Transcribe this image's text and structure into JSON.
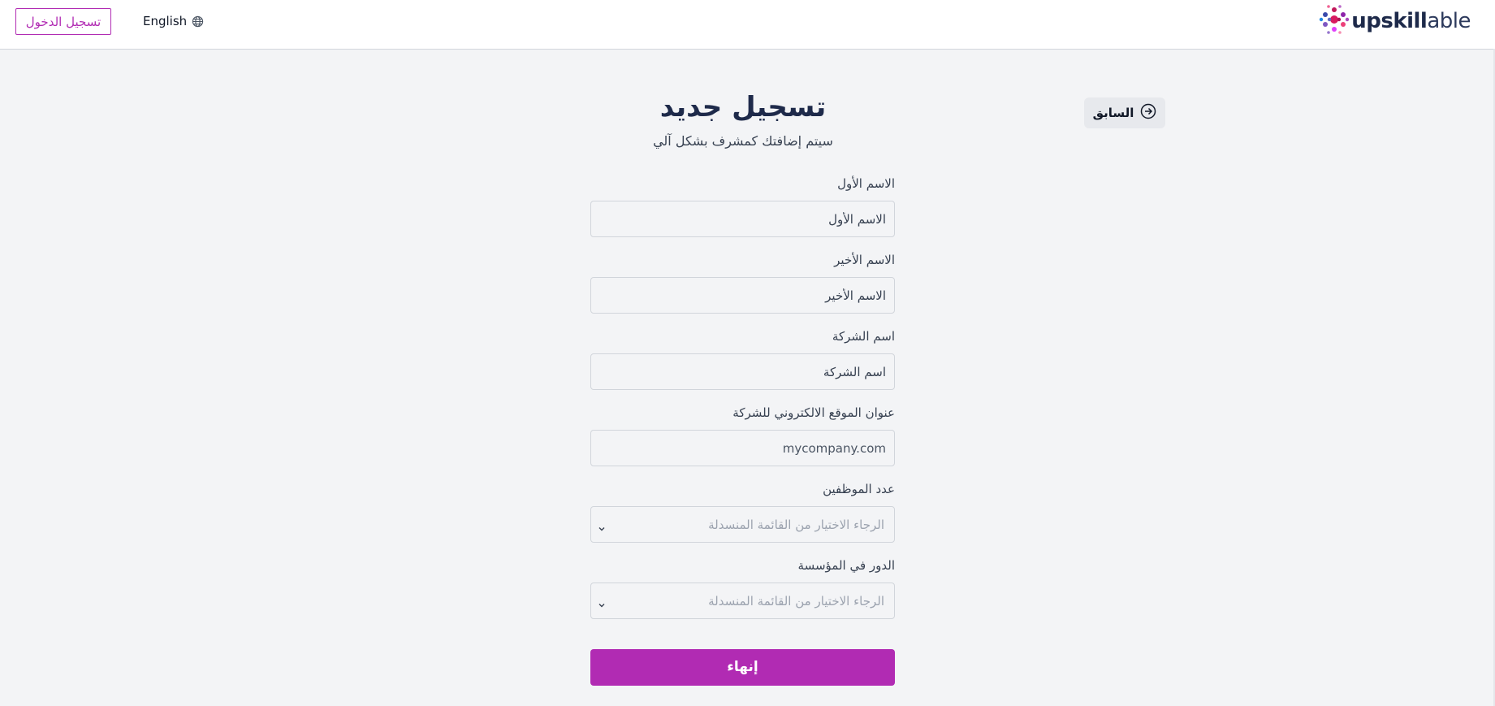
{
  "header": {
    "login_label": "تسجيل الدخول",
    "language_label": "English",
    "language_icon": "globe-icon",
    "logo": {
      "text_bold": "upskill",
      "text_light": "able",
      "icon": "upskillable-logo-mark"
    }
  },
  "back": {
    "label": "السابق",
    "icon": "arrow-circle-right-icon"
  },
  "page": {
    "title": "تسجيل جديد",
    "subtitle": "سيتم إضافتك كمشرف بشكل آلي"
  },
  "form": {
    "first_name": {
      "label": "الاسم الأول",
      "placeholder": "الاسم الأول"
    },
    "last_name": {
      "label": "الاسم الأخير",
      "placeholder": "الاسم الأخير"
    },
    "company_name": {
      "label": "اسم الشركة",
      "placeholder": "اسم الشركة"
    },
    "company_website": {
      "label": "عنوان الموقع الالكتروني للشركة",
      "placeholder": "mycompany.com"
    },
    "employee_count": {
      "label": "عدد الموظفين",
      "placeholder": "الرجاء الاختيار من القائمة المنسدلة"
    },
    "org_role": {
      "label": "الدور في المؤسسة",
      "placeholder": "الرجاء الاختيار من القائمة المنسدلة"
    },
    "submit_label": "إنهاء"
  },
  "colors": {
    "accent": "#b12bb3",
    "background": "#f3f4f6",
    "title": "#1e2a4a"
  }
}
